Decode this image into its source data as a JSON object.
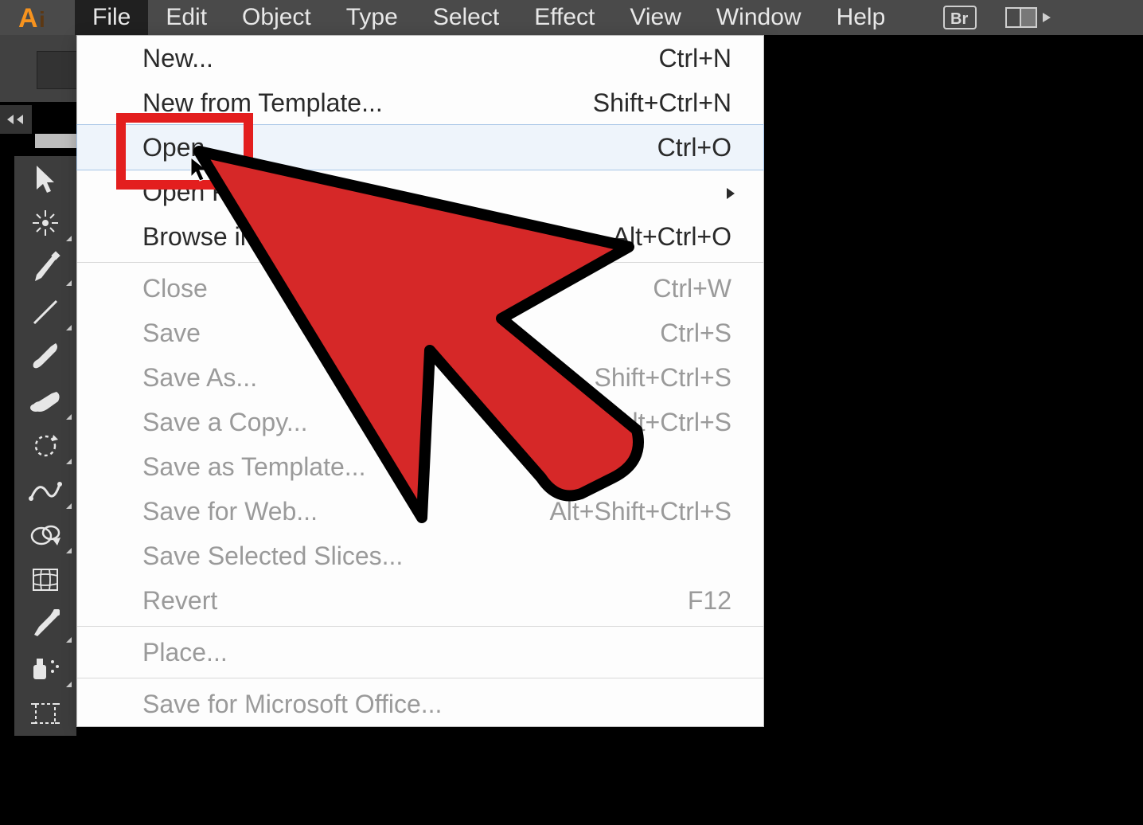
{
  "app": {
    "name": "Adobe Illustrator",
    "iconLetters": "Ai"
  },
  "menubar": {
    "items": [
      {
        "label": "File",
        "active": true
      },
      {
        "label": "Edit",
        "active": false
      },
      {
        "label": "Object",
        "active": false
      },
      {
        "label": "Type",
        "active": false
      },
      {
        "label": "Select",
        "active": false
      },
      {
        "label": "Effect",
        "active": false
      },
      {
        "label": "View",
        "active": false
      },
      {
        "label": "Window",
        "active": false
      },
      {
        "label": "Help",
        "active": false
      }
    ],
    "rightIcons": [
      {
        "name": "bridge-icon",
        "label": "Br"
      },
      {
        "name": "arrange-documents-icon",
        "label": ""
      }
    ]
  },
  "toolbar": {
    "tools": [
      {
        "name": "selection-tool",
        "hasCorner": false
      },
      {
        "name": "magic-wand-tool",
        "hasCorner": true
      },
      {
        "name": "pen-tool",
        "hasCorner": true
      },
      {
        "name": "line-segment-tool",
        "hasCorner": true
      },
      {
        "name": "paintbrush-tool",
        "hasCorner": false
      },
      {
        "name": "blob-brush-tool",
        "hasCorner": true
      },
      {
        "name": "rotate-tool",
        "hasCorner": true
      },
      {
        "name": "width-tool",
        "hasCorner": true
      },
      {
        "name": "shape-builder-tool",
        "hasCorner": true
      },
      {
        "name": "mesh-tool",
        "hasCorner": false
      },
      {
        "name": "eyedropper-tool",
        "hasCorner": true
      },
      {
        "name": "symbol-sprayer-tool",
        "hasCorner": true
      },
      {
        "name": "artboard-tool",
        "hasCorner": false
      }
    ]
  },
  "fileMenu": {
    "groups": [
      [
        {
          "label": "New...",
          "shortcut": "Ctrl+N",
          "disabled": false,
          "submenu": false,
          "hovered": false
        },
        {
          "label": "New from Template...",
          "shortcut": "Shift+Ctrl+N",
          "disabled": false,
          "submenu": false,
          "hovered": false
        },
        {
          "label": "Open...",
          "shortcut": "Ctrl+O",
          "disabled": false,
          "submenu": false,
          "hovered": true
        },
        {
          "label": "Open Recent Files",
          "shortcut": "",
          "disabled": false,
          "submenu": true,
          "hovered": false
        },
        {
          "label": "Browse in Bridge...",
          "shortcut": "Alt+Ctrl+O",
          "disabled": false,
          "submenu": false,
          "hovered": false
        }
      ],
      [
        {
          "label": "Close",
          "shortcut": "Ctrl+W",
          "disabled": true,
          "submenu": false,
          "hovered": false
        },
        {
          "label": "Save",
          "shortcut": "Ctrl+S",
          "disabled": true,
          "submenu": false,
          "hovered": false
        },
        {
          "label": "Save As...",
          "shortcut": "Shift+Ctrl+S",
          "disabled": true,
          "submenu": false,
          "hovered": false
        },
        {
          "label": "Save a Copy...",
          "shortcut": "Alt+Ctrl+S",
          "disabled": true,
          "submenu": false,
          "hovered": false
        },
        {
          "label": "Save as Template...",
          "shortcut": "",
          "disabled": true,
          "submenu": false,
          "hovered": false
        },
        {
          "label": "Save for Web...",
          "shortcut": "Alt+Shift+Ctrl+S",
          "disabled": true,
          "submenu": false,
          "hovered": false
        },
        {
          "label": "Save Selected Slices...",
          "shortcut": "",
          "disabled": true,
          "submenu": false,
          "hovered": false
        },
        {
          "label": "Revert",
          "shortcut": "F12",
          "disabled": true,
          "submenu": false,
          "hovered": false
        }
      ],
      [
        {
          "label": "Place...",
          "shortcut": "",
          "disabled": true,
          "submenu": false,
          "hovered": false
        }
      ],
      [
        {
          "label": "Save for Microsoft Office...",
          "shortcut": "",
          "disabled": true,
          "submenu": false,
          "hovered": false
        }
      ]
    ]
  },
  "annotation": {
    "redBoxTarget": "Open...",
    "bigArrow": true
  }
}
